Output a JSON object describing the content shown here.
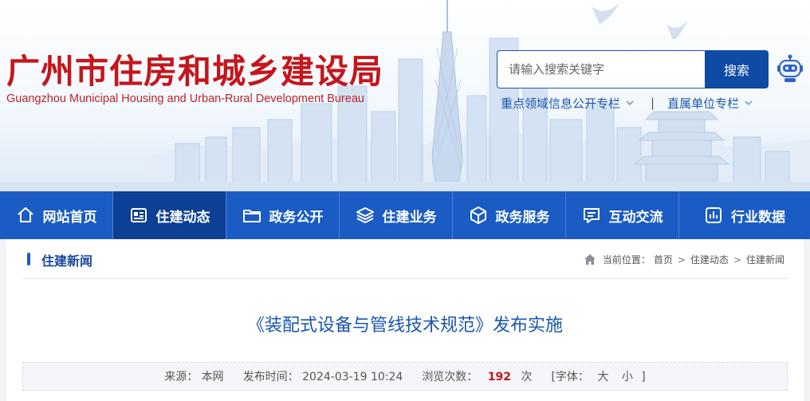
{
  "header": {
    "title": "广州市住房和城乡建设局",
    "subtitle": "Guangzhou Municipal Housing and Urban-Rural Development Bureau",
    "search": {
      "placeholder": "请输入搜索关键字",
      "button_label": "搜索"
    },
    "quick_links": [
      {
        "label": "重点领域信息公开专栏"
      },
      {
        "label": "直属单位专栏"
      }
    ],
    "separator": "|"
  },
  "nav": {
    "items": [
      {
        "label": "网站首页",
        "icon": "home-icon",
        "active": false
      },
      {
        "label": "住建动态",
        "icon": "news-icon",
        "active": true
      },
      {
        "label": "政务公开",
        "icon": "folder-icon",
        "active": false
      },
      {
        "label": "住建业务",
        "icon": "layers-icon",
        "active": false
      },
      {
        "label": "政务服务",
        "icon": "box-icon",
        "active": false
      },
      {
        "label": "互动交流",
        "icon": "chat-icon",
        "active": false
      },
      {
        "label": "行业数据",
        "icon": "bar-chart-icon",
        "active": false
      }
    ]
  },
  "content": {
    "section_title": "住建新闻",
    "breadcrumb": {
      "prefix": "当前位置：",
      "items": [
        "首页",
        "住建动态",
        "住建新闻"
      ],
      "separator": ">"
    },
    "article": {
      "title": "《装配式设备与管线技术规范》发布实施",
      "source_label": "来源：",
      "source": "本网",
      "published_label": "发布时间：",
      "published": "2024-03-19 10:24",
      "views_label": "浏览次数：",
      "views": "192",
      "views_unit": "次",
      "font_label": "[字体：",
      "font_large": "大",
      "font_small": "小",
      "font_close": "]"
    }
  },
  "colors": {
    "brand_red": "#c4161c",
    "nav_blue": "#1a5cc4",
    "nav_active": "#0d3f94",
    "link_blue": "#1a56b0"
  }
}
